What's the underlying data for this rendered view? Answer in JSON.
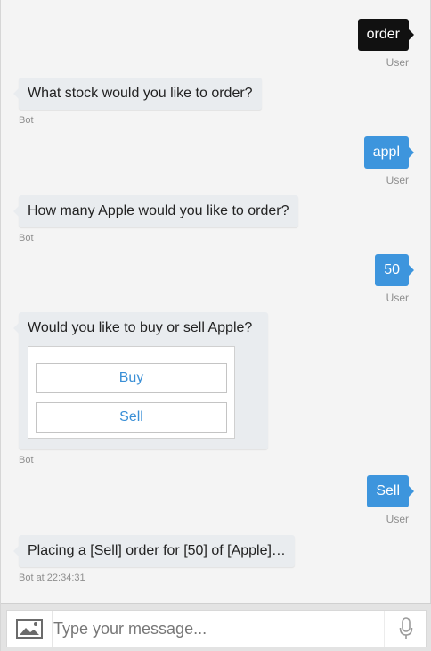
{
  "colors": {
    "user_black": "#111111",
    "user_blue": "#3d95dd",
    "bot_bubble": "#e9ecef",
    "choice_text": "#3a8fd6",
    "meta_text": "#8f8f8f"
  },
  "messages": [
    {
      "sender": "user",
      "text": "order",
      "meta": "User",
      "style": "dark"
    },
    {
      "sender": "bot",
      "text": "What stock would you like to order?",
      "meta": "Bot"
    },
    {
      "sender": "user",
      "text": "appl",
      "meta": "User",
      "style": "blue"
    },
    {
      "sender": "bot",
      "text": "How many Apple would you like to order?",
      "meta": "Bot"
    },
    {
      "sender": "user",
      "text": "50",
      "meta": "User",
      "style": "blue"
    },
    {
      "sender": "bot",
      "text": "Would you like to buy or sell Apple?",
      "meta": "Bot",
      "choices": [
        "Buy",
        "Sell"
      ]
    },
    {
      "sender": "user",
      "text": "Sell",
      "meta": "User",
      "style": "blue"
    },
    {
      "sender": "bot",
      "text": "Placing a [Sell] order for [50] of [Apple]…",
      "meta": "Bot at 22:34:31"
    }
  ],
  "composer": {
    "placeholder": "Type your message...",
    "image_button_icon": "image-icon",
    "mic_button_icon": "microphone-icon"
  }
}
